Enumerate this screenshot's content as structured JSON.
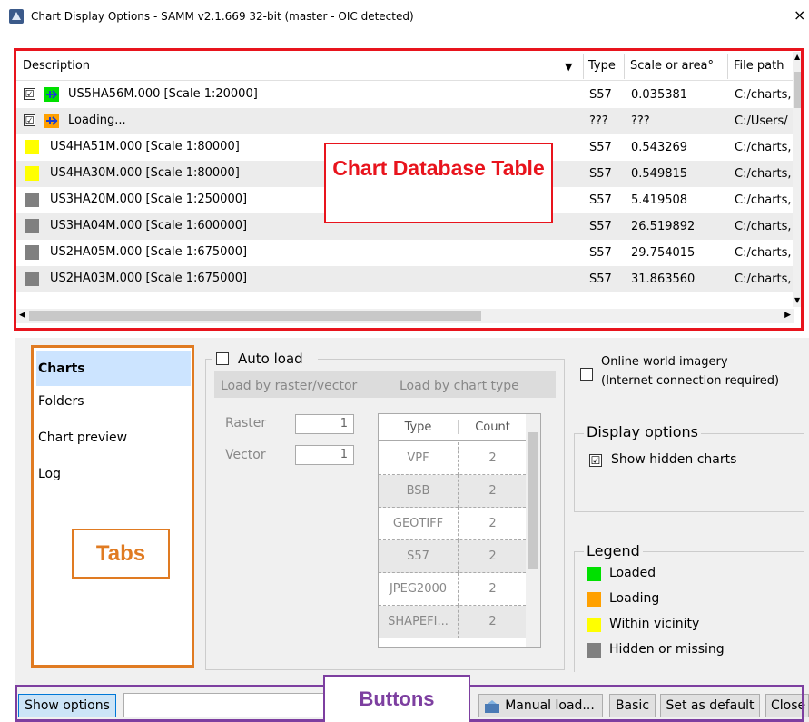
{
  "window": {
    "title": "Chart Display Options - SAMM v2.1.669 32-bit (master - OIC detected)",
    "close_glyph": "×"
  },
  "table": {
    "headers": {
      "description": "Description",
      "type": "Type",
      "scale": "Scale or area°",
      "path": "File path"
    },
    "rows": [
      {
        "checked": "☑",
        "color": "#00e000",
        "icon": "loaded-chart-icon",
        "description": "US5HA56M.000 [Scale 1:20000]",
        "type": "S57",
        "scale": "0.035381",
        "path": "C:/charts,"
      },
      {
        "checked": "☑",
        "color": "#ffa000",
        "icon": "loading-chart-icon",
        "description": "Loading...",
        "type": "???",
        "scale": "???",
        "path": "C:/Users/"
      },
      {
        "checked": "",
        "color": "#ffff00",
        "icon": "vicinity-chart-icon",
        "description": "US4HA51M.000 [Scale 1:80000]",
        "type": "S57",
        "scale": "0.543269",
        "path": "C:/charts,"
      },
      {
        "checked": "",
        "color": "#ffff00",
        "icon": "vicinity-chart-icon",
        "description": "US4HA30M.000 [Scale 1:80000]",
        "type": "S57",
        "scale": "0.549815",
        "path": "C:/charts,"
      },
      {
        "checked": "",
        "color": "#808080",
        "icon": "hidden-chart-icon",
        "description": "US3HA20M.000 [Scale 1:250000]",
        "type": "S57",
        "scale": "5.419508",
        "path": "C:/charts,"
      },
      {
        "checked": "",
        "color": "#808080",
        "icon": "hidden-chart-icon",
        "description": "US3HA04M.000 [Scale 1:600000]",
        "type": "S57",
        "scale": "26.519892",
        "path": "C:/charts,"
      },
      {
        "checked": "",
        "color": "#808080",
        "icon": "hidden-chart-icon",
        "description": "US2HA05M.000 [Scale 1:675000]",
        "type": "S57",
        "scale": "29.754015",
        "path": "C:/charts,"
      },
      {
        "checked": "",
        "color": "#808080",
        "icon": "hidden-chart-icon",
        "description": "US2HA03M.000 [Scale 1:675000]",
        "type": "S57",
        "scale": "31.863560",
        "path": "C:/charts,"
      }
    ]
  },
  "annotations": {
    "table_label": "Chart Database Table",
    "tabs_label": "Tabs",
    "buttons_label": "Buttons"
  },
  "tabs": [
    "Charts",
    "Folders",
    "Chart preview",
    "Log"
  ],
  "autoload": {
    "label": "Auto load",
    "by_raster": "Load by raster/vector",
    "by_type": "Load by chart type",
    "raster_label": "Raster",
    "raster_value": "1",
    "vector_label": "Vector",
    "vector_value": "1",
    "type_header": "Type",
    "count_header": "Count",
    "types": [
      {
        "type": "VPF",
        "count": "2"
      },
      {
        "type": "BSB",
        "count": "2"
      },
      {
        "type": "GEOTIFF",
        "count": "2"
      },
      {
        "type": "S57",
        "count": "2"
      },
      {
        "type": "JPEG2000",
        "count": "2"
      },
      {
        "type": "SHAPEFI...",
        "count": "2"
      }
    ]
  },
  "online": {
    "line1": "Online world imagery",
    "line2": "(Internet connection required)"
  },
  "display_options": {
    "title": "Display options",
    "show_hidden": "Show hidden charts"
  },
  "legend": {
    "title": "Legend",
    "items": [
      {
        "label": "Loaded",
        "color": "#00e000"
      },
      {
        "label": "Loading",
        "color": "#ffa000"
      },
      {
        "label": "Within vicinity",
        "color": "#ffff00"
      },
      {
        "label": "Hidden or missing",
        "color": "#808080"
      }
    ]
  },
  "buttons": {
    "show_options": "Show options",
    "manual_load": "Manual load...",
    "basic": "Basic",
    "set_default": "Set as default",
    "close": "Close"
  },
  "colors": {
    "table_annotation": "#e8141d",
    "tabs_annotation": "#e07b22",
    "buttons_annotation": "#7d3fa0"
  }
}
